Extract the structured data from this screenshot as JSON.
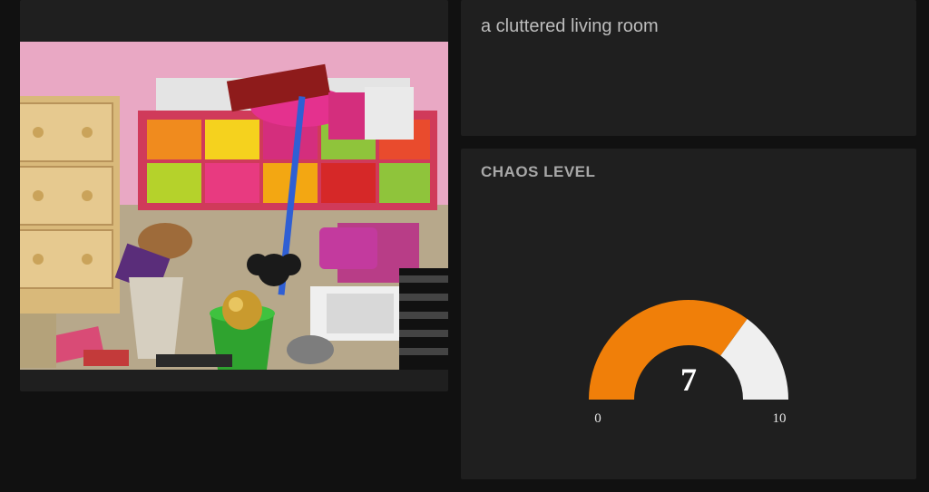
{
  "caption": {
    "text": "a cluttered living room"
  },
  "gauge": {
    "title": "CHAOS LEVEL",
    "value": 7,
    "min": 0,
    "max": 10,
    "active_color": "#f07f09",
    "track_color": "#efefef"
  },
  "chart_data": {
    "type": "gauge",
    "title": "CHAOS LEVEL",
    "value": 7,
    "min": 0,
    "max": 10,
    "tick_labels": [
      "0",
      "10"
    ]
  }
}
